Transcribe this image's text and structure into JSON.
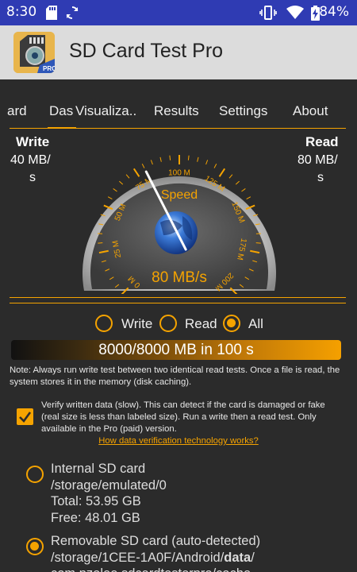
{
  "status_bar": {
    "time": "8:30",
    "battery": "84%",
    "icons": [
      "sd-card-icon",
      "sync-icon",
      "vibrate-icon",
      "wifi-icon",
      "battery-charging-icon"
    ]
  },
  "app": {
    "title": "SD Card Test Pro"
  },
  "tabs": [
    {
      "label": "ard",
      "active": false
    },
    {
      "label": "Das",
      "active": true
    },
    {
      "label": "Visualiza..",
      "active": false
    },
    {
      "label": "Results",
      "active": false
    },
    {
      "label": "Settings",
      "active": false
    },
    {
      "label": "About",
      "active": false
    }
  ],
  "write": {
    "label": "Write",
    "value_line1": "40 MB/",
    "value_line2": "s"
  },
  "read": {
    "label": "Read",
    "value_line1": "80 MB/",
    "value_line2": "s"
  },
  "gauge": {
    "title": "Speed",
    "readout": "80 MB/s",
    "ticks": [
      "0 M",
      "25 M",
      "50 M",
      "75 M",
      "100 M",
      "125 M",
      "150 M",
      "175 M",
      "200 M"
    ],
    "value_mb_s": 80,
    "max_mb_s": 200
  },
  "mode": {
    "options": [
      "Write",
      "Read",
      "All"
    ],
    "selected": "All"
  },
  "progress": {
    "text": "8000/8000 MB in 100 s",
    "fraction": 1.0
  },
  "note": "Note: Always run write test between two identical read tests. Once a file is read, the system stores it in the memory (disk caching).",
  "verify": {
    "checked": true,
    "text": "Verify written data (slow). This can detect if the card is damaged or fake (real size is less than labeled size). Run a write then a read test. Only available in the Pro (paid) version.",
    "link": "How data verification technology works?"
  },
  "storage": [
    {
      "selected": false,
      "name": "Internal SD card",
      "path": "/storage/emulated/0",
      "total": "Total: 53.95 GB",
      "free": "Free: 48.01 GB"
    },
    {
      "selected": true,
      "name": "Removable SD card (auto-detected)",
      "path_prefix": "/storage/1CEE-1A0F/Android/",
      "path_bold": "data",
      "path_suffix": "/",
      "path_line2": "com.pzolee.sdcardtesterpro/cache"
    }
  ],
  "colors": {
    "accent": "#f5a300",
    "statusbar": "#2f3bb3",
    "appbar": "#dcdcdc",
    "background": "#2b2b2b"
  }
}
